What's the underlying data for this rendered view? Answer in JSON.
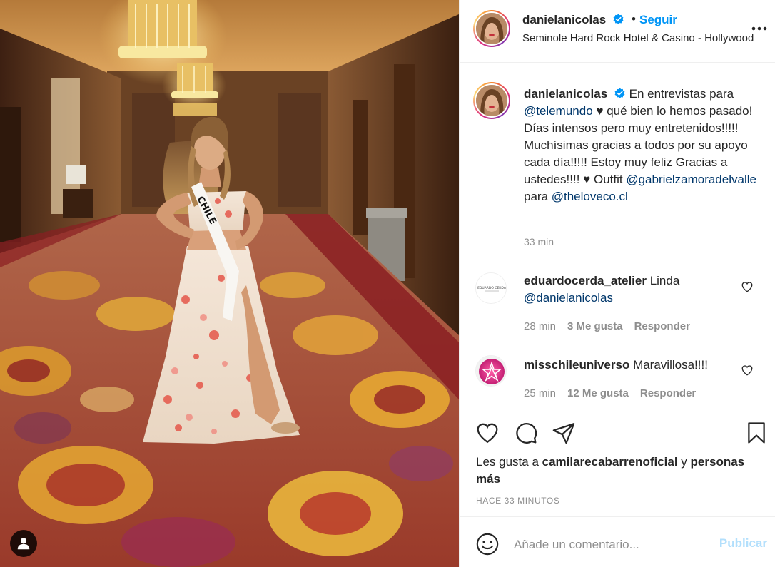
{
  "post": {
    "image_alt": "Woman in floral gown with CHILE sash standing in a hotel hallway with patterned carpet and chandeliers",
    "sash_text": "CHILE"
  },
  "header": {
    "username": "danielanicolas",
    "separator": "•",
    "follow_label": "Seguir",
    "location": "Seminole Hard Rock Hotel & Casino - Hollywood"
  },
  "caption": {
    "username": "danielanicolas",
    "text_1": " En entrevistas para ",
    "mention_1": "@telemundo",
    "text_2": " ♥ qué bien lo hemos pasado! Días intensos pero muy entretenidos!!!!! Muchísimas gracias a todos por su apoyo cada día!!!!! Estoy muy feliz Gracias a ustedes!!!! ♥ Outfit ",
    "mention_2": "@gabrielzamoradelvalle",
    "text_3": " para ",
    "mention_3": "@theloveco.cl",
    "time": "33 min"
  },
  "comments": [
    {
      "username": "eduardocerda_atelier",
      "text": " Linda ",
      "mention": "@danielanicolas",
      "avatar_text": "EDUARDO CERDA",
      "time": "28 min",
      "likes": "3 Me gusta",
      "reply": "Responder"
    },
    {
      "username": "misschileuniverso",
      "text": " Maravillosa!!!!",
      "mention": "",
      "time": "25 min",
      "likes": "12 Me gusta",
      "reply": "Responder"
    }
  ],
  "actions": {
    "likes_prefix": "Les gusta a ",
    "likes_user": "camilarecabarrenoficial",
    "likes_middle": " y ",
    "likes_others": "personas más",
    "post_time": "HACE 33 MINUTOS"
  },
  "comment_box": {
    "placeholder": "Añade un comentario...",
    "publish_label": "Publicar"
  },
  "colors": {
    "accent_blue": "#0095f6",
    "mention_blue": "#00376b",
    "publish_disabled": "#b2dffc",
    "muted_text": "#8e8e8e",
    "divider": "#efefef"
  },
  "icons": [
    "verified-badge-icon",
    "more-options-icon",
    "heart-icon",
    "comment-icon",
    "share-icon",
    "bookmark-icon",
    "emoji-icon",
    "user-tag-icon"
  ]
}
